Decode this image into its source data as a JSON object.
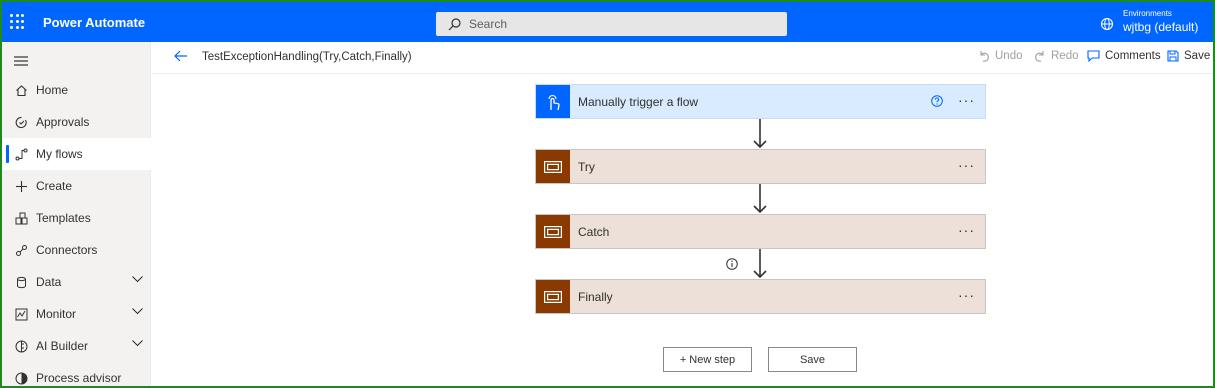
{
  "app": {
    "title": "Power Automate"
  },
  "search": {
    "placeholder": "Search"
  },
  "environment": {
    "label": "Environments",
    "name": "wjtbg (default)"
  },
  "sidebar": {
    "items": [
      {
        "label": "Home",
        "icon": "home-icon"
      },
      {
        "label": "Approvals",
        "icon": "approvals-icon"
      },
      {
        "label": "My flows",
        "icon": "flows-icon",
        "active": true
      },
      {
        "label": "Create",
        "icon": "plus-icon"
      },
      {
        "label": "Templates",
        "icon": "templates-icon"
      },
      {
        "label": "Connectors",
        "icon": "connectors-icon"
      },
      {
        "label": "Data",
        "icon": "data-icon",
        "expandable": true
      },
      {
        "label": "Monitor",
        "icon": "monitor-icon",
        "expandable": true
      },
      {
        "label": "AI Builder",
        "icon": "ai-builder-icon",
        "expandable": true
      },
      {
        "label": "Process advisor",
        "icon": "process-advisor-icon"
      }
    ]
  },
  "commandbar": {
    "flow_name": "TestExceptionHandling(Try,Catch,Finally)",
    "undo": "Undo",
    "redo": "Redo",
    "comments": "Comments",
    "save": "Save"
  },
  "flow": {
    "steps": [
      {
        "label": "Manually trigger a flow",
        "kind": "trigger"
      },
      {
        "label": "Try",
        "kind": "scope"
      },
      {
        "label": "Catch",
        "kind": "scope"
      },
      {
        "label": "Finally",
        "kind": "scope"
      }
    ],
    "more_glyph": "···",
    "new_step_label": "+ New step",
    "save_label": "Save"
  },
  "colors": {
    "brand": "#0066ff",
    "scope_icon": "#8a3a00",
    "scope_bg": "#ede0d8",
    "trigger_bg": "#d9ebff"
  }
}
